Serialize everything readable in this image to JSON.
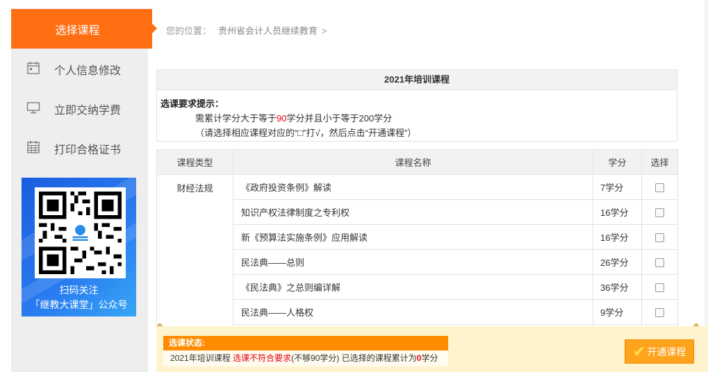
{
  "sidebar": {
    "active_item": {
      "label": "选择课程"
    },
    "items": [
      {
        "label": "个人信息修改",
        "icon": "calendar-icon"
      },
      {
        "label": "立即交纳学费",
        "icon": "monitor-icon"
      },
      {
        "label": "打印合格证书",
        "icon": "grid-calendar-icon"
      }
    ],
    "qr": {
      "line1": "扫码关注",
      "line2": "「继教大课堂」公众号"
    }
  },
  "breadcrumb": {
    "prefix": "您的位置：",
    "site": "贵州省会计人员继续教育",
    "separator": ">"
  },
  "course_panel": {
    "title": "2021年培训课程",
    "requirement": {
      "title": "选课要求提示：",
      "line1_before": "需累计学分大于等于",
      "line1_highlight": "90",
      "line1_after": "学分并且小于等于200学分",
      "line2": "（请选择相应课程对应的“□”打√，然后点击“开通课程”）"
    }
  },
  "table": {
    "headers": {
      "category": "课程类型",
      "name": "课程名称",
      "credit": "学分",
      "select": "选择"
    },
    "category": "财经法规",
    "rows": [
      {
        "name": "《政府投资条例》解读",
        "credit": "7学分"
      },
      {
        "name": "知识产权法律制度之专利权",
        "credit": "16学分"
      },
      {
        "name": "新《预算法实施条例》应用解读",
        "credit": "16学分"
      },
      {
        "name": "民法典——总则",
        "credit": "26学分"
      },
      {
        "name": "《民法典》之总则编详解",
        "credit": "36学分"
      },
      {
        "name": "民法典——人格权",
        "credit": "9学分"
      },
      {
        "name": "",
        "credit": ""
      }
    ]
  },
  "status": {
    "head": "选课状态:",
    "course": "2021年培训课程",
    "state": "选课不符合要求",
    "detail": "(不够90学分) 已选择的课程累计为",
    "total": "0",
    "unit": "学分",
    "button": "开通课程"
  },
  "colors": {
    "accent": "#ff6f12",
    "status_head": "#ff8c00",
    "button": "#ffa21c",
    "highlight": "#e60012"
  }
}
